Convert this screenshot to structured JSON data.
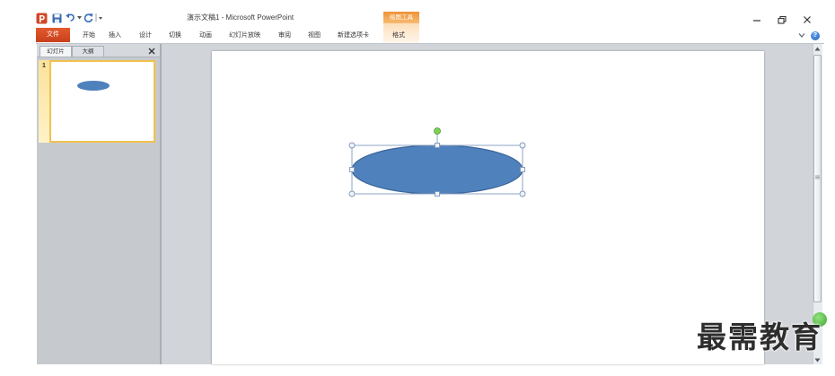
{
  "app": {
    "title": "演示文稿1 - Microsoft PowerPoint"
  },
  "qat": {
    "icons": [
      "powerpoint-logo-icon",
      "save-icon",
      "undo-icon",
      "undo-dropdown-icon",
      "redo-icon",
      "customize-qat-icon"
    ]
  },
  "window_controls": {
    "icons": [
      "minimize-icon",
      "restore-icon",
      "close-icon"
    ]
  },
  "ribbon": {
    "file_tab": "文件",
    "tabs": [
      "开始",
      "插入",
      "设计",
      "切换",
      "动画",
      "幻灯片放映",
      "审阅",
      "视图",
      "新建选项卡"
    ],
    "contextual_group": "绘图工具",
    "contextual_tab": "格式",
    "help": "?",
    "icons": [
      "ribbon-expand-icon",
      "help-icon"
    ]
  },
  "slides_pane": {
    "tabs": [
      "幻灯片",
      "大纲"
    ],
    "active_tab_index": 0,
    "icons": [
      "pane-close-icon"
    ],
    "thumbnails": [
      {
        "number": "1",
        "selected": true
      }
    ]
  },
  "slide": {
    "selected_shape_count": 1
  },
  "scrollbar": {
    "icons": [
      "scroll-up-icon",
      "scroll-down-icon"
    ]
  },
  "watermark": "最需教育",
  "colors": {
    "file_tab": "#d24726",
    "contextual_group": "#f39c42",
    "shape_fill": "#4f81bd",
    "shape_outline": "#3b6497",
    "selection_handle": "#7f97b9",
    "rotate_handle": "#7ed158",
    "selected_thumbnail_border": "#f2c14e",
    "slides_pane_bg": "#c6cace",
    "workspace_bg": "#d1d4d8",
    "watermark": "#2d2d2d"
  }
}
